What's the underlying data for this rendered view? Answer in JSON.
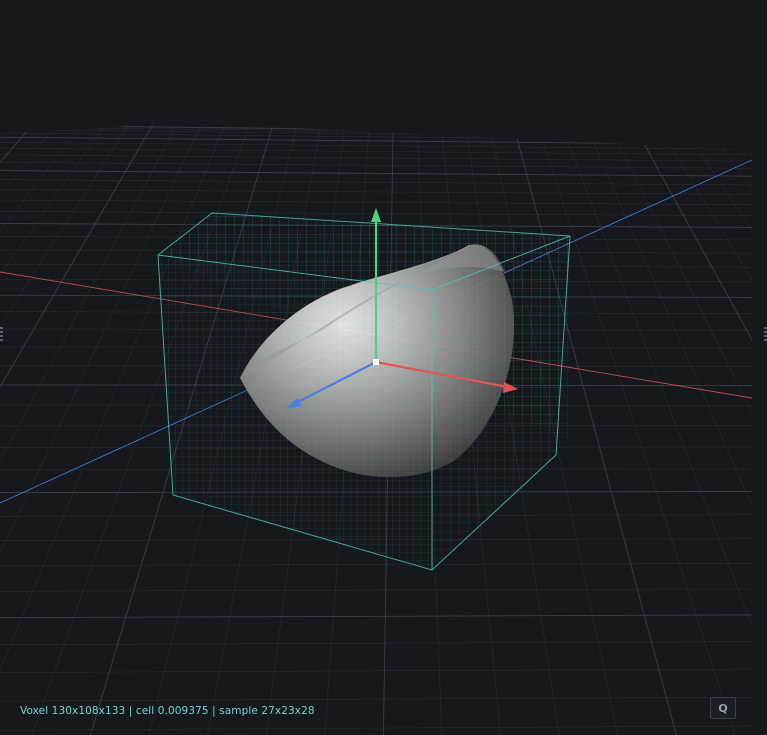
{
  "viewport": {
    "background": "#15191e",
    "grid_color": "#3e4650",
    "axis_x_color": "#e05555",
    "axis_y_color": "#53d17a",
    "axis_z_color": "#4a7fe0",
    "voxel_box_color": "#4fc8b8"
  },
  "status_bar": {
    "text": "Voxel 130x108x133 | cell 0.009375 | sample 27x23x28"
  },
  "quality_button": {
    "label": "Q"
  },
  "icons": {
    "gizmo": "transform-gizmo-icon",
    "resize_left": "resize-handle-icon",
    "resize_right": "resize-handle-icon"
  }
}
